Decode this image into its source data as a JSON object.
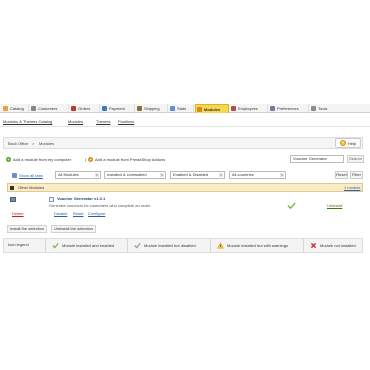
{
  "tabs": [
    {
      "label": "Catalog",
      "color": "#e6a23c"
    },
    {
      "label": "Customers",
      "color": "#7f8c8d"
    },
    {
      "label": "Orders",
      "color": "#c0392b"
    },
    {
      "label": "Payment",
      "color": "#3b7bbf"
    },
    {
      "label": "Shipping",
      "color": "#8e6b3b"
    },
    {
      "label": "Stats",
      "color": "#5b8fd6"
    },
    {
      "label": "Modules",
      "color": "#d68a1a",
      "active": true
    },
    {
      "label": "Employees",
      "color": "#b84a4a"
    },
    {
      "label": "Preferences",
      "color": "#6f7f99"
    },
    {
      "label": "Tools",
      "color": "#8c8c8c"
    }
  ],
  "submenu": [
    "Modules & Themes Catalog",
    "Modules",
    "Themes",
    "Positions"
  ],
  "breadcrumb": {
    "root": "Back Office",
    "separator": ">",
    "current": "Modules"
  },
  "help_button": "Help",
  "add_from_computer": "Add a module from my computer",
  "add_from_addons": "Add a module from PrestaShop Addons",
  "search": {
    "value": "Voucher Generator",
    "button": "Search"
  },
  "show_icons": "Show all tabs",
  "filters": {
    "modules": "All Modules",
    "installed": "Installed & Uninstalled",
    "enabled": "Enabled & Disabled",
    "countries": "All countries"
  },
  "reset_label": "Reset",
  "filter_label": "Filter",
  "category": {
    "name": "Other Modules",
    "count": "1 module"
  },
  "module": {
    "name": "Voucher Generator v1.0.1",
    "description": "Generate vouchers for customers who complete an order.",
    "actions": {
      "delete": "Delete",
      "disable": "Disable",
      "reset": "Reset",
      "configure": "Configure"
    },
    "status_action": "Uninstall"
  },
  "bottom_buttons": [
    "Install the selection",
    "Uninstall the selection"
  ],
  "legend": {
    "title": "Icon legend",
    "items": [
      {
        "label": "Module installed and enabled",
        "icon": "check"
      },
      {
        "label": "Module installed but disabled",
        "icon": "check-grey"
      },
      {
        "label": "Module installed but with warnings",
        "icon": "warning"
      },
      {
        "label": "Module not installed",
        "icon": "cross"
      }
    ]
  },
  "colors": {
    "active_tab": "#f9d652",
    "category_bg": "#fbecc8",
    "delete": "#c02020",
    "link": "#2a5db0",
    "ok": "#7ab648"
  }
}
